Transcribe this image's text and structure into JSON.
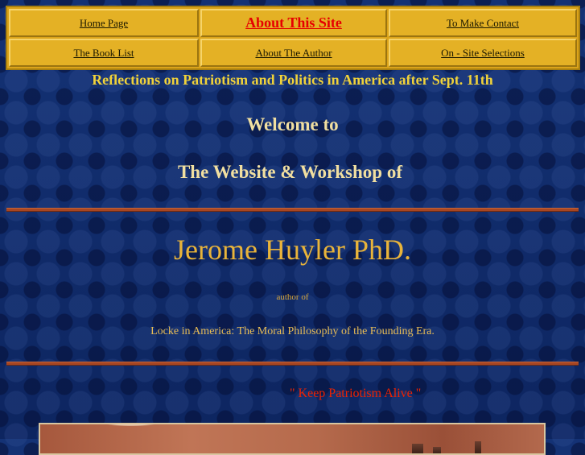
{
  "nav": {
    "home": "Home Page",
    "about_site": "About This Site",
    "contact": "To Make Contact",
    "book_list": "The Book List",
    "about_author": "About The Author",
    "selections": "On - Site Selections"
  },
  "colors": {
    "background": "#0f2a6b",
    "nav_bg": "#e4b125",
    "active_link": "#e60000",
    "heading": "#f1dfa0",
    "subtitle": "#f0d23a",
    "name": "#e9b43a",
    "rule": "#a84622",
    "slogan": "#ee2200"
  },
  "header": {
    "subtitle": "Reflections on Patriotism and Politics in America after Sept. 11th",
    "welcome": "Welcome to",
    "website": "The Website & Workshop of"
  },
  "author": {
    "name": "Jerome Huyler PhD.",
    "author_of": "author of",
    "book": "Locke in America:  The Moral Philosophy of the Founding Era."
  },
  "slogan": "\" Keep Patriotism Alive \""
}
